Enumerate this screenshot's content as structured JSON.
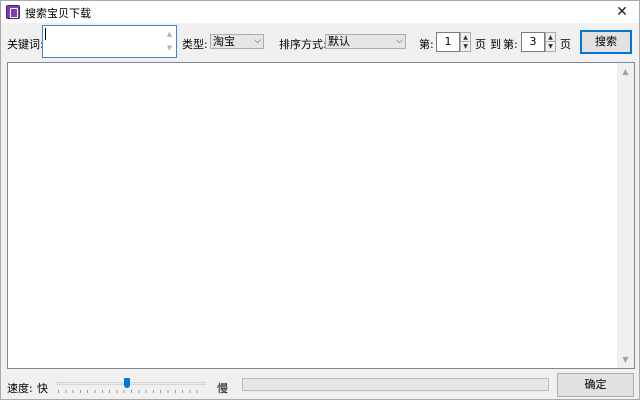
{
  "window": {
    "title": "搜索宝贝下载",
    "close_glyph": "✕"
  },
  "toolbar": {
    "keyword_label": "关键词:",
    "keyword_value": "",
    "type_label": "类型:",
    "type_value": "淘宝",
    "sort_label": "排序方式:",
    "sort_value": "默认",
    "page_from_label": "第:",
    "page_from_value": "1",
    "page_label_1": "页",
    "page_to_label_a": "到",
    "page_to_label_b": "第:",
    "page_to_value": "3",
    "page_label_2": "页",
    "search_label": "搜索"
  },
  "bottom": {
    "speed_label": "速度:",
    "fast_label": "快",
    "slow_label": "慢",
    "speed_fraction": 0.47,
    "progress_fraction": 0,
    "ok_label": "确定"
  },
  "icons": {
    "app": "app-icon",
    "dropdown": "chevron-down-icon",
    "spin_up": "spin-up-icon",
    "spin_down": "spin-down-icon"
  }
}
